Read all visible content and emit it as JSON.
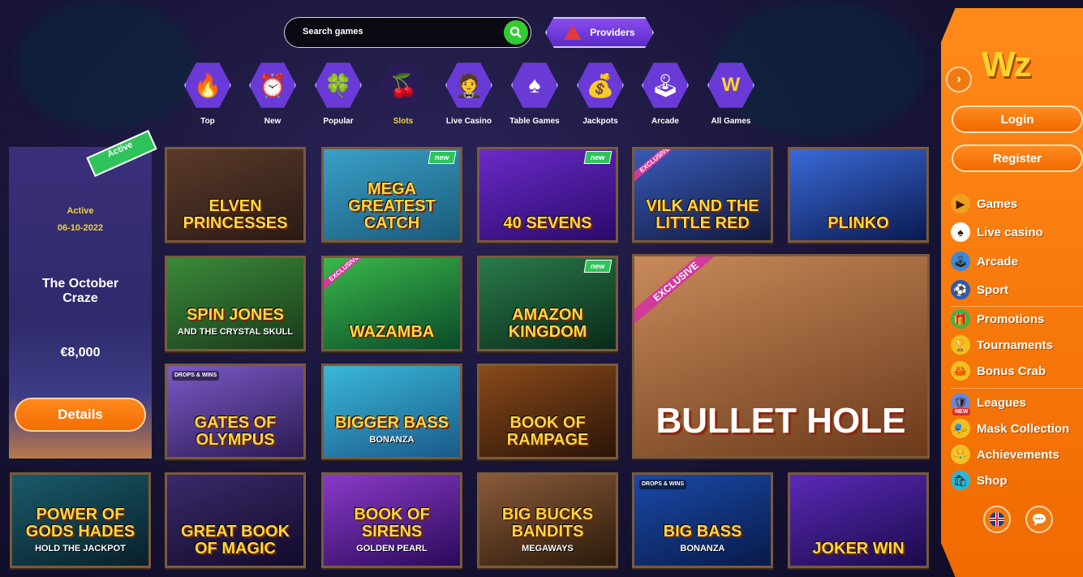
{
  "search": {
    "placeholder": "Search games"
  },
  "providers_label": "Providers",
  "categories": [
    {
      "label": "Top",
      "icon": "🔥"
    },
    {
      "label": "New",
      "icon": "⏰"
    },
    {
      "label": "Popular",
      "icon": "🍀"
    },
    {
      "label": "Slots",
      "icon": "🍒",
      "active": true
    },
    {
      "label": "Live Casino",
      "icon": "🤵"
    },
    {
      "label": "Table Games",
      "icon": "♠"
    },
    {
      "label": "Jackpots",
      "icon": "💰"
    },
    {
      "label": "Arcade",
      "icon": "🕹"
    },
    {
      "label": "All Games",
      "icon": "W"
    }
  ],
  "promo": {
    "ribbon": "Active",
    "status": "Active",
    "date": "06-10-2022",
    "title": "The October Craze",
    "amount": "€8,000",
    "details_label": "Details"
  },
  "tags": {
    "new": "new",
    "exclusive": "EXCLUSIVE",
    "drops": "DROPS & WINS"
  },
  "games": [
    {
      "title": "ELVEN PRINCESSES",
      "sub": "",
      "colors": [
        "#5a3a2a",
        "#2a1a14"
      ]
    },
    {
      "title": "MEGA GREATEST CATCH",
      "sub": "",
      "colors": [
        "#3aa0c8",
        "#1a5a7a"
      ],
      "new": true
    },
    {
      "title": "40 SEVENS",
      "sub": "",
      "colors": [
        "#6a2ac8",
        "#2a0a6a"
      ],
      "new": true
    },
    {
      "title": "VILK AND THE LITTLE RED",
      "sub": "",
      "colors": [
        "#3a5ab8",
        "#101a40"
      ],
      "exclusive": true
    },
    {
      "title": "PLINKO",
      "sub": "",
      "colors": [
        "#3a6ad8",
        "#0a1a50"
      ]
    },
    {
      "title": "SPIN JONES",
      "sub": "AND THE CRYSTAL SKULL",
      "colors": [
        "#3a8a3a",
        "#1a3a1a"
      ]
    },
    {
      "title": "WAZAMBA",
      "sub": "",
      "colors": [
        "#3ab84a",
        "#0a4a2a"
      ],
      "exclusive": true
    },
    {
      "title": "AMAZON KINGDOM",
      "sub": "",
      "colors": [
        "#2a7a4a",
        "#0a2a1a"
      ],
      "new": true
    },
    {
      "title": "GATES OF OLYMPUS",
      "sub": "",
      "colors": [
        "#7a5ac8",
        "#2a1a50"
      ],
      "drops": true
    },
    {
      "title": "BIGGER BASS",
      "sub": "BONANZA",
      "colors": [
        "#3ab8d8",
        "#1a5a8a"
      ]
    },
    {
      "title": "BOOK OF RAMPAGE",
      "sub": "",
      "colors": [
        "#8a4a1a",
        "#2a1408"
      ]
    },
    {
      "title": "POWER OF GODS HADES",
      "sub": "HOLD THE JACKPOT",
      "colors": [
        "#1a5a6a",
        "#08202a"
      ]
    },
    {
      "title": "GREAT BOOK OF MAGIC",
      "sub": "",
      "colors": [
        "#3a2a6a",
        "#120a2a"
      ]
    },
    {
      "title": "BOOK OF SIRENS",
      "sub": "GOLDEN PEARL",
      "colors": [
        "#8a3ac8",
        "#2a0a5a"
      ]
    },
    {
      "title": "BIG BUCKS BANDITS",
      "sub": "MEGAWAYS",
      "colors": [
        "#8a5a3a",
        "#2a1a0a"
      ]
    },
    {
      "title": "BIG BASS",
      "sub": "BONANZA",
      "colors": [
        "#1a4aa8",
        "#081a4a"
      ],
      "drops": true
    },
    {
      "title": "JOKER WIN",
      "sub": "",
      "colors": [
        "#5a2ab8",
        "#1a0a4a"
      ]
    }
  ],
  "featured": {
    "title": "BULLET HOLE",
    "colors": [
      "#c88a5a",
      "#6a3a1a"
    ],
    "exclusive": true
  },
  "sidebar": {
    "logo": "Wz",
    "login_label": "Login",
    "register_label": "Register",
    "items": [
      {
        "label": "Games",
        "icon": "▶",
        "color": "#f0a020"
      },
      {
        "label": "Live casino",
        "icon": "♠",
        "color": "#ffffff"
      },
      {
        "label": "Arcade",
        "icon": "🕹",
        "color": "#3a8ad8"
      },
      {
        "label": "Sport",
        "icon": "⚽",
        "color": "#2a5ab8"
      },
      {
        "label": "Promotions",
        "icon": "🎁",
        "color": "#3ab84a"
      },
      {
        "label": "Tournaments",
        "icon": "🏆",
        "color": "#f0c020"
      },
      {
        "label": "Bonus Crab",
        "icon": "🦀",
        "color": "#f0c020"
      },
      {
        "label": "Leagues",
        "icon": "🛡",
        "color": "#6a8ad8"
      },
      {
        "label": "Mask Collection",
        "icon": "🎭",
        "color": "#f0c020"
      },
      {
        "label": "Achievements",
        "icon": "👑",
        "color": "#f0c020"
      },
      {
        "label": "Shop",
        "icon": "🛍",
        "color": "#2ab8d8"
      }
    ],
    "new_badge": "NEW",
    "language_flag": "UK",
    "chat_icon": "chat-icon"
  }
}
